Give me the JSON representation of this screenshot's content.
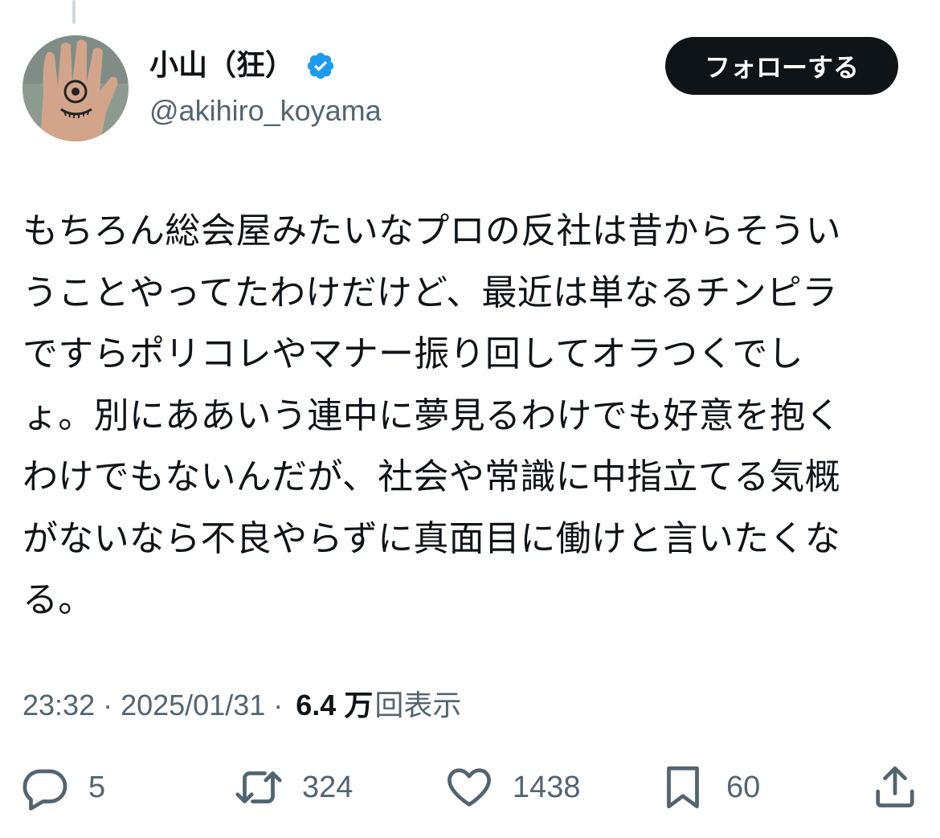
{
  "author": {
    "display_name": "小山（狂）",
    "handle": "@akihiro_koyama",
    "verified": true,
    "avatar": "hand-with-eye-drawing"
  },
  "follow_button": {
    "label": "フォローする"
  },
  "tweet": {
    "lines": [
      "もちろん総会屋みたいなプロの反社は昔からそうい",
      "うことやってたわけだけど、最近は単なるチンピラ",
      "ですらポリコレやマナー振り回してオラつくでし",
      "ょ。別にああいう連中に夢見るわけでも好意を抱く",
      "わけでもないんだが、社会や常識に中指立てる気概",
      "がないなら不良やらずに真面目に働けと言いたくな",
      "る。"
    ]
  },
  "meta": {
    "time": "23:32",
    "separator": "·",
    "date": "2025/01/31",
    "views_count": "6.4 万",
    "views_label": "回表示"
  },
  "actions": {
    "replies": "5",
    "reposts": "324",
    "likes": "1438",
    "bookmarks": "60"
  },
  "colors": {
    "text": "#0f1419",
    "secondary": "#536471",
    "verified_blue": "#1d9bf0",
    "button_bg": "#0f1419"
  }
}
